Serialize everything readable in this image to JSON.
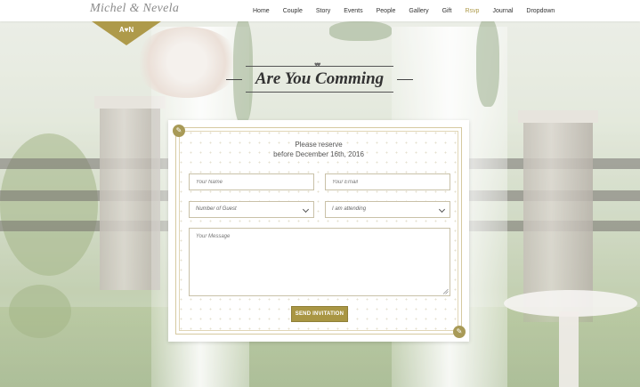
{
  "brand": {
    "name": "Michel & Nevela",
    "badge": "A♥N"
  },
  "nav": {
    "items": [
      {
        "label": "Home"
      },
      {
        "label": "Couple"
      },
      {
        "label": "Story"
      },
      {
        "label": "Events"
      },
      {
        "label": "People"
      },
      {
        "label": "Gallery"
      },
      {
        "label": "Gift"
      },
      {
        "label": "Rsvp",
        "active": true
      },
      {
        "label": "Journal"
      },
      {
        "label": "Dropdown"
      }
    ]
  },
  "section": {
    "heading": "Are You Comming"
  },
  "form": {
    "reserve_line1": "Please reserve",
    "reserve_line2": "before December 16th, 2016",
    "name_placeholder": "Your Name",
    "email_placeholder": "Your Email",
    "guests_selected": "Number of Guest",
    "attending_selected": "I am attending",
    "message_placeholder": "Your Message",
    "submit_label": "SEND INVITATION"
  },
  "colors": {
    "accent": "#ae9a4a",
    "button": "#a99644",
    "border": "#c9c1a8"
  },
  "icons": {
    "corner": "pin-icon",
    "select": "chevron-down-icon",
    "heading": "hearts-icon"
  }
}
